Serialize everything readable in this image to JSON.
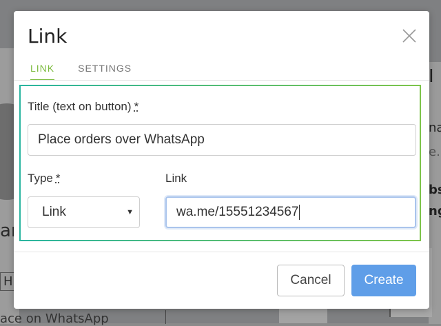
{
  "dialog": {
    "title": "Link",
    "tabs": [
      {
        "label": "LINK",
        "active": true
      },
      {
        "label": "SETTINGS",
        "active": false
      }
    ],
    "fields": {
      "title_label": "Title (text on button)",
      "title_required": "*",
      "title_value": "Place orders over WhatsApp",
      "type_label": "Type",
      "type_required": "*",
      "type_value": "Link",
      "link_label": "Link",
      "link_value": "wa.me/15551234567"
    },
    "buttons": {
      "cancel": "Cancel",
      "create": "Create"
    }
  },
  "background": {
    "fragment_left_1": "an",
    "fragment_left_2": "HI",
    "fragment_left_3": "ace on WhatsApp",
    "fragment_right_1": "I",
    "fragment_right_2": "na",
    "fragment_right_3": "e.u",
    "fragment_right_4": "bs",
    "fragment_right_5": "ng"
  },
  "colors": {
    "accent_tab": "#7dbb3f",
    "primary_button": "#5f9ee8",
    "panel_gradient_start": "#2ab5a0",
    "panel_gradient_end": "#7dc44a"
  }
}
